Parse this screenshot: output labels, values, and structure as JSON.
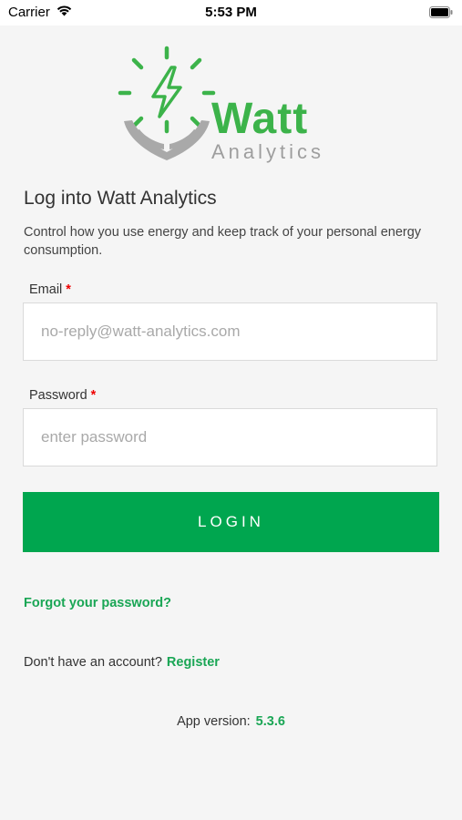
{
  "status_bar": {
    "carrier": "Carrier",
    "time": "5:53 PM",
    "icons": [
      "wifi-icon",
      "battery-icon"
    ]
  },
  "logo": {
    "word1": "Watt",
    "word2": "Analytics",
    "colors": {
      "green": "#3cb34a",
      "gray": "#9e9e9e"
    }
  },
  "header": {
    "title": "Log into Watt Analytics",
    "subtitle": "Control how you use energy and keep track of your personal energy consumption."
  },
  "form": {
    "email": {
      "label": "Email",
      "required_mark": "*",
      "value": "",
      "placeholder": "no-reply@watt-analytics.com"
    },
    "password": {
      "label": "Password",
      "required_mark": "*",
      "value": "",
      "placeholder": "enter password"
    },
    "login_label": "LOGIN"
  },
  "links": {
    "forgot_password": "Forgot your password?",
    "no_account": "Don't have an account?",
    "register": "Register"
  },
  "footer": {
    "version_label": "App version:",
    "version_value": "5.3.6"
  },
  "colors": {
    "accent": "#00a64f",
    "link": "#1aa655",
    "required": "#e00000",
    "background": "#f5f5f5"
  }
}
